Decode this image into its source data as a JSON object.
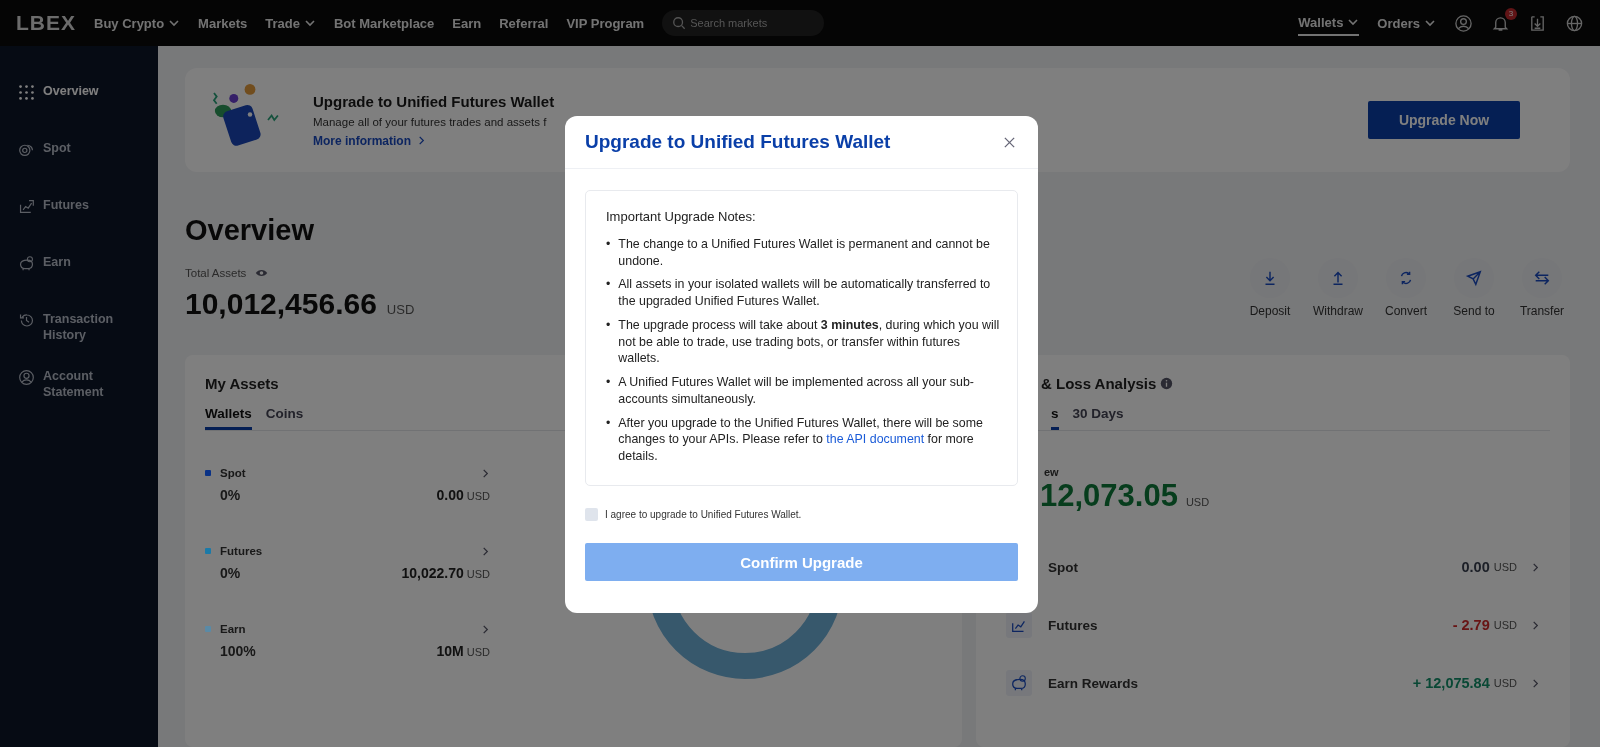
{
  "nav": {
    "logo": "LBEX",
    "items": [
      {
        "label": "Buy Crypto",
        "dropdown": true
      },
      {
        "label": "Markets",
        "dropdown": false
      },
      {
        "label": "Trade",
        "dropdown": true
      },
      {
        "label": "Bot Marketplace",
        "dropdown": false
      },
      {
        "label": "Earn",
        "dropdown": false
      },
      {
        "label": "Referral",
        "dropdown": false
      },
      {
        "label": "VIP Program",
        "dropdown": false
      }
    ],
    "search": {
      "placeholder": "Search markets"
    },
    "right_items": [
      {
        "label": "Wallets",
        "selected": true
      },
      {
        "label": "Orders",
        "selected": false
      }
    ],
    "notification_count": "3"
  },
  "sidebar": {
    "items": [
      {
        "label": "Overview",
        "selected": true
      },
      {
        "label": "Spot",
        "selected": false
      },
      {
        "label": "Futures",
        "selected": false
      },
      {
        "label": "Earn",
        "selected": false
      },
      {
        "label": "Transaction History",
        "selected": false
      },
      {
        "label": "Account Statement",
        "selected": false
      }
    ]
  },
  "banner": {
    "title": "Upgrade to Unified Futures Wallet",
    "text": "Manage all of your futures trades and assets f",
    "link": "More information",
    "button": "Upgrade Now"
  },
  "overview": {
    "title": "Overview",
    "total_label": "Total Assets",
    "total": "10,012,456.66",
    "currency": "USD",
    "actions": [
      {
        "label": "Deposit"
      },
      {
        "label": "Withdraw"
      },
      {
        "label": "Convert"
      },
      {
        "label": "Send to"
      },
      {
        "label": "Transfer"
      }
    ]
  },
  "my_assets": {
    "title": "My Assets",
    "tabs": [
      {
        "label": "Wallets",
        "selected": true
      },
      {
        "label": "Coins",
        "selected": false
      }
    ],
    "wallets": [
      {
        "name": "Spot",
        "color": "#0a3286",
        "percent": "0%",
        "amount": "0.00",
        "currency": "USD"
      },
      {
        "name": "Futures",
        "color": "#1b7aa8",
        "percent": "0%",
        "amount": "10,022.70",
        "currency": "USD"
      },
      {
        "name": "Earn",
        "color": "#5a8aa6",
        "percent": "100%",
        "amount": "10M",
        "currency": "USD"
      }
    ]
  },
  "pnl": {
    "title": "& Loss Analysis",
    "tabs": [
      {
        "label": "s",
        "selected": true
      },
      {
        "label": "30 Days",
        "selected": false
      }
    ],
    "label": "ew",
    "total": "12,073.05",
    "currency": "USD",
    "rows": [
      {
        "name": "Spot",
        "kind": "neutral",
        "value": "0.00",
        "currency": "USD"
      },
      {
        "name": "Futures",
        "kind": "loss",
        "value": "- 2.79",
        "currency": "USD"
      },
      {
        "name": "Earn Rewards",
        "kind": "gain",
        "value": "+ 12,075.84",
        "currency": "USD"
      }
    ]
  },
  "modal": {
    "title": "Upgrade to Unified Futures Wallet",
    "notes_title": "Important Upgrade Notes:",
    "bullet": "•",
    "notes": [
      "The change to a Unified Futures Wallet is permanent and cannot be undone.",
      "All assets in your isolated wallets will be automatically transferred to the upgraded Unified Futures Wallet.",
      "The upgrade process will take about **3 minutes**, during which you will not be able to trade, use trading bots, or transfer within futures wallets.",
      "A Unified Futures Wallet will be implemented across all your sub-accounts simultaneously."
    ],
    "last_note": {
      "before": "After you upgrade to the Unified Futures Wallet, there will be some changes to your APIs. Please refer to",
      "link": "the API document",
      "after": "for more details."
    },
    "agree": {
      "label": "I agree to upgrade to Unified Futures Wallet.",
      "checked": false
    },
    "confirm": {
      "label": "Confirm Upgrade",
      "disabled": true
    }
  }
}
